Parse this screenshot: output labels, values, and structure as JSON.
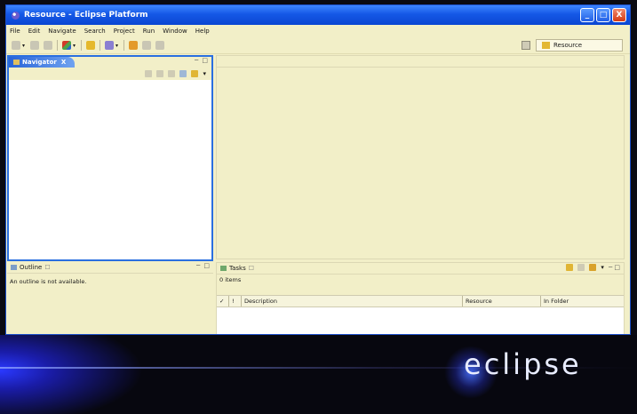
{
  "window": {
    "title": "Resource - Eclipse Platform",
    "controls": {
      "minimize": "_",
      "maximize": "□",
      "close": "X"
    }
  },
  "menu": [
    "File",
    "Edit",
    "Navigate",
    "Search",
    "Project",
    "Run",
    "Window",
    "Help"
  ],
  "toolbar": {
    "dropdown_glyph": "▾"
  },
  "perspective": {
    "label": "Resource"
  },
  "navigator": {
    "tab_label": "Navigator",
    "tab_close": "X",
    "view_controls": "─ □"
  },
  "outline": {
    "tab_label": "Outline",
    "tab_close": "☐",
    "view_controls": "─ □",
    "message": "An outline is not available."
  },
  "tasks": {
    "tab_label": "Tasks",
    "tab_close": "☐",
    "view_controls": "─ □",
    "items_count": "0 items",
    "columns": [
      "✓",
      "!",
      "Description",
      "Resource",
      "In Folder"
    ]
  },
  "banner": {
    "logo_text": "eclipse"
  },
  "colors": {
    "title_bar": "#1558e6",
    "workbench_bg": "#f2efc8",
    "active_tab": "#2864d8",
    "banner_bg": "#07070f"
  }
}
